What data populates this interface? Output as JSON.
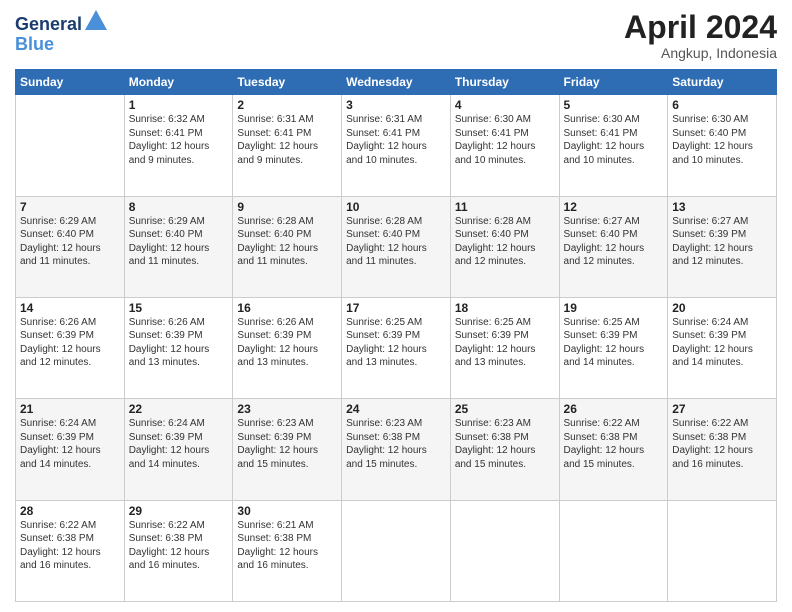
{
  "header": {
    "logo_line1": "General",
    "logo_line2": "Blue",
    "month": "April 2024",
    "location": "Angkup, Indonesia"
  },
  "days_of_week": [
    "Sunday",
    "Monday",
    "Tuesday",
    "Wednesday",
    "Thursday",
    "Friday",
    "Saturday"
  ],
  "weeks": [
    [
      {
        "day": "",
        "info": ""
      },
      {
        "day": "1",
        "info": "Sunrise: 6:32 AM\nSunset: 6:41 PM\nDaylight: 12 hours\nand 9 minutes."
      },
      {
        "day": "2",
        "info": "Sunrise: 6:31 AM\nSunset: 6:41 PM\nDaylight: 12 hours\nand 9 minutes."
      },
      {
        "day": "3",
        "info": "Sunrise: 6:31 AM\nSunset: 6:41 PM\nDaylight: 12 hours\nand 10 minutes."
      },
      {
        "day": "4",
        "info": "Sunrise: 6:30 AM\nSunset: 6:41 PM\nDaylight: 12 hours\nand 10 minutes."
      },
      {
        "day": "5",
        "info": "Sunrise: 6:30 AM\nSunset: 6:41 PM\nDaylight: 12 hours\nand 10 minutes."
      },
      {
        "day": "6",
        "info": "Sunrise: 6:30 AM\nSunset: 6:40 PM\nDaylight: 12 hours\nand 10 minutes."
      }
    ],
    [
      {
        "day": "7",
        "info": "Sunrise: 6:29 AM\nSunset: 6:40 PM\nDaylight: 12 hours\nand 11 minutes."
      },
      {
        "day": "8",
        "info": "Sunrise: 6:29 AM\nSunset: 6:40 PM\nDaylight: 12 hours\nand 11 minutes."
      },
      {
        "day": "9",
        "info": "Sunrise: 6:28 AM\nSunset: 6:40 PM\nDaylight: 12 hours\nand 11 minutes."
      },
      {
        "day": "10",
        "info": "Sunrise: 6:28 AM\nSunset: 6:40 PM\nDaylight: 12 hours\nand 11 minutes."
      },
      {
        "day": "11",
        "info": "Sunrise: 6:28 AM\nSunset: 6:40 PM\nDaylight: 12 hours\nand 12 minutes."
      },
      {
        "day": "12",
        "info": "Sunrise: 6:27 AM\nSunset: 6:40 PM\nDaylight: 12 hours\nand 12 minutes."
      },
      {
        "day": "13",
        "info": "Sunrise: 6:27 AM\nSunset: 6:39 PM\nDaylight: 12 hours\nand 12 minutes."
      }
    ],
    [
      {
        "day": "14",
        "info": "Sunrise: 6:26 AM\nSunset: 6:39 PM\nDaylight: 12 hours\nand 12 minutes."
      },
      {
        "day": "15",
        "info": "Sunrise: 6:26 AM\nSunset: 6:39 PM\nDaylight: 12 hours\nand 13 minutes."
      },
      {
        "day": "16",
        "info": "Sunrise: 6:26 AM\nSunset: 6:39 PM\nDaylight: 12 hours\nand 13 minutes."
      },
      {
        "day": "17",
        "info": "Sunrise: 6:25 AM\nSunset: 6:39 PM\nDaylight: 12 hours\nand 13 minutes."
      },
      {
        "day": "18",
        "info": "Sunrise: 6:25 AM\nSunset: 6:39 PM\nDaylight: 12 hours\nand 13 minutes."
      },
      {
        "day": "19",
        "info": "Sunrise: 6:25 AM\nSunset: 6:39 PM\nDaylight: 12 hours\nand 14 minutes."
      },
      {
        "day": "20",
        "info": "Sunrise: 6:24 AM\nSunset: 6:39 PM\nDaylight: 12 hours\nand 14 minutes."
      }
    ],
    [
      {
        "day": "21",
        "info": "Sunrise: 6:24 AM\nSunset: 6:39 PM\nDaylight: 12 hours\nand 14 minutes."
      },
      {
        "day": "22",
        "info": "Sunrise: 6:24 AM\nSunset: 6:39 PM\nDaylight: 12 hours\nand 14 minutes."
      },
      {
        "day": "23",
        "info": "Sunrise: 6:23 AM\nSunset: 6:39 PM\nDaylight: 12 hours\nand 15 minutes."
      },
      {
        "day": "24",
        "info": "Sunrise: 6:23 AM\nSunset: 6:38 PM\nDaylight: 12 hours\nand 15 minutes."
      },
      {
        "day": "25",
        "info": "Sunrise: 6:23 AM\nSunset: 6:38 PM\nDaylight: 12 hours\nand 15 minutes."
      },
      {
        "day": "26",
        "info": "Sunrise: 6:22 AM\nSunset: 6:38 PM\nDaylight: 12 hours\nand 15 minutes."
      },
      {
        "day": "27",
        "info": "Sunrise: 6:22 AM\nSunset: 6:38 PM\nDaylight: 12 hours\nand 16 minutes."
      }
    ],
    [
      {
        "day": "28",
        "info": "Sunrise: 6:22 AM\nSunset: 6:38 PM\nDaylight: 12 hours\nand 16 minutes."
      },
      {
        "day": "29",
        "info": "Sunrise: 6:22 AM\nSunset: 6:38 PM\nDaylight: 12 hours\nand 16 minutes."
      },
      {
        "day": "30",
        "info": "Sunrise: 6:21 AM\nSunset: 6:38 PM\nDaylight: 12 hours\nand 16 minutes."
      },
      {
        "day": "",
        "info": ""
      },
      {
        "day": "",
        "info": ""
      },
      {
        "day": "",
        "info": ""
      },
      {
        "day": "",
        "info": ""
      }
    ]
  ]
}
